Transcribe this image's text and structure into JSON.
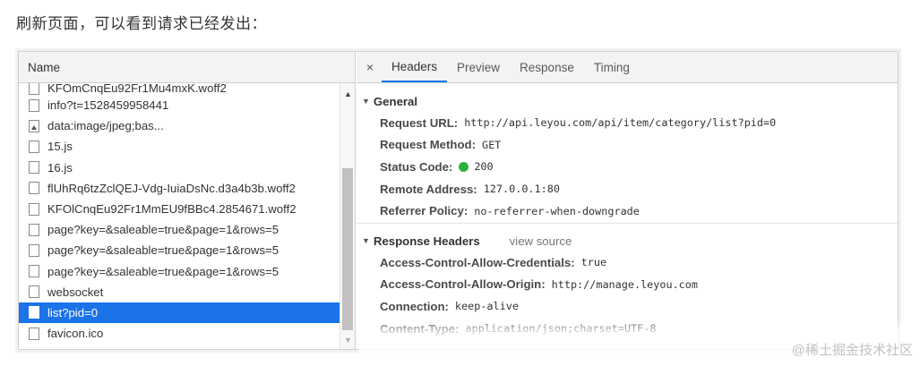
{
  "caption": "刷新页面，可以看到请求已经发出：",
  "left_pane": {
    "header": "Name",
    "requests": [
      {
        "name": "KFOmCnqEu92Fr1Mu4mxK.woff2",
        "icon": "file-icon"
      },
      {
        "name": "info?t=1528459958441",
        "icon": "file-icon"
      },
      {
        "name": "data:image/jpeg;bas...",
        "icon": "image-file-icon"
      },
      {
        "name": "15.js",
        "icon": "file-icon"
      },
      {
        "name": "16.js",
        "icon": "file-icon"
      },
      {
        "name": "flUhRq6tzZclQEJ-Vdg-IuiaDsNc.d3a4b3b.woff2",
        "icon": "file-icon"
      },
      {
        "name": "KFOlCnqEu92Fr1MmEU9fBBc4.2854671.woff2",
        "icon": "file-icon"
      },
      {
        "name": "page?key=&saleable=true&page=1&rows=5",
        "icon": "file-icon"
      },
      {
        "name": "page?key=&saleable=true&page=1&rows=5",
        "icon": "file-icon"
      },
      {
        "name": "page?key=&saleable=true&page=1&rows=5",
        "icon": "file-icon"
      },
      {
        "name": "websocket",
        "icon": "file-icon"
      },
      {
        "name": "list?pid=0",
        "icon": "file-icon",
        "selected": true
      },
      {
        "name": "favicon.ico",
        "icon": "file-icon"
      }
    ]
  },
  "tabs": {
    "close": "×",
    "items": [
      "Headers",
      "Preview",
      "Response",
      "Timing"
    ],
    "active": "Headers"
  },
  "general": {
    "title": "General",
    "request_url": {
      "key": "Request URL:",
      "value": "http://api.leyou.com/api/item/category/list?pid=0"
    },
    "request_method": {
      "key": "Request Method:",
      "value": "GET"
    },
    "status_code": {
      "key": "Status Code:",
      "value": "200",
      "status_color": "#2fae3d"
    },
    "remote_address": {
      "key": "Remote Address:",
      "value": "127.0.0.1:80"
    },
    "referrer_policy": {
      "key": "Referrer Policy:",
      "value": "no-referrer-when-downgrade"
    }
  },
  "response_headers": {
    "title": "Response Headers",
    "view_source": "view source",
    "acac": {
      "key": "Access-Control-Allow-Credentials:",
      "value": "true"
    },
    "acao": {
      "key": "Access-Control-Allow-Origin:",
      "value": "http://manage.leyou.com"
    },
    "connection": {
      "key": "Connection:",
      "value": "keep-alive"
    },
    "content_type": {
      "key": "Content-Type:",
      "value": "application/json;charset=UTF-8"
    }
  },
  "watermark": "@稀土掘金技术社区",
  "colors": {
    "accent": "#1a73e8",
    "status_ok": "#2fae3d"
  }
}
